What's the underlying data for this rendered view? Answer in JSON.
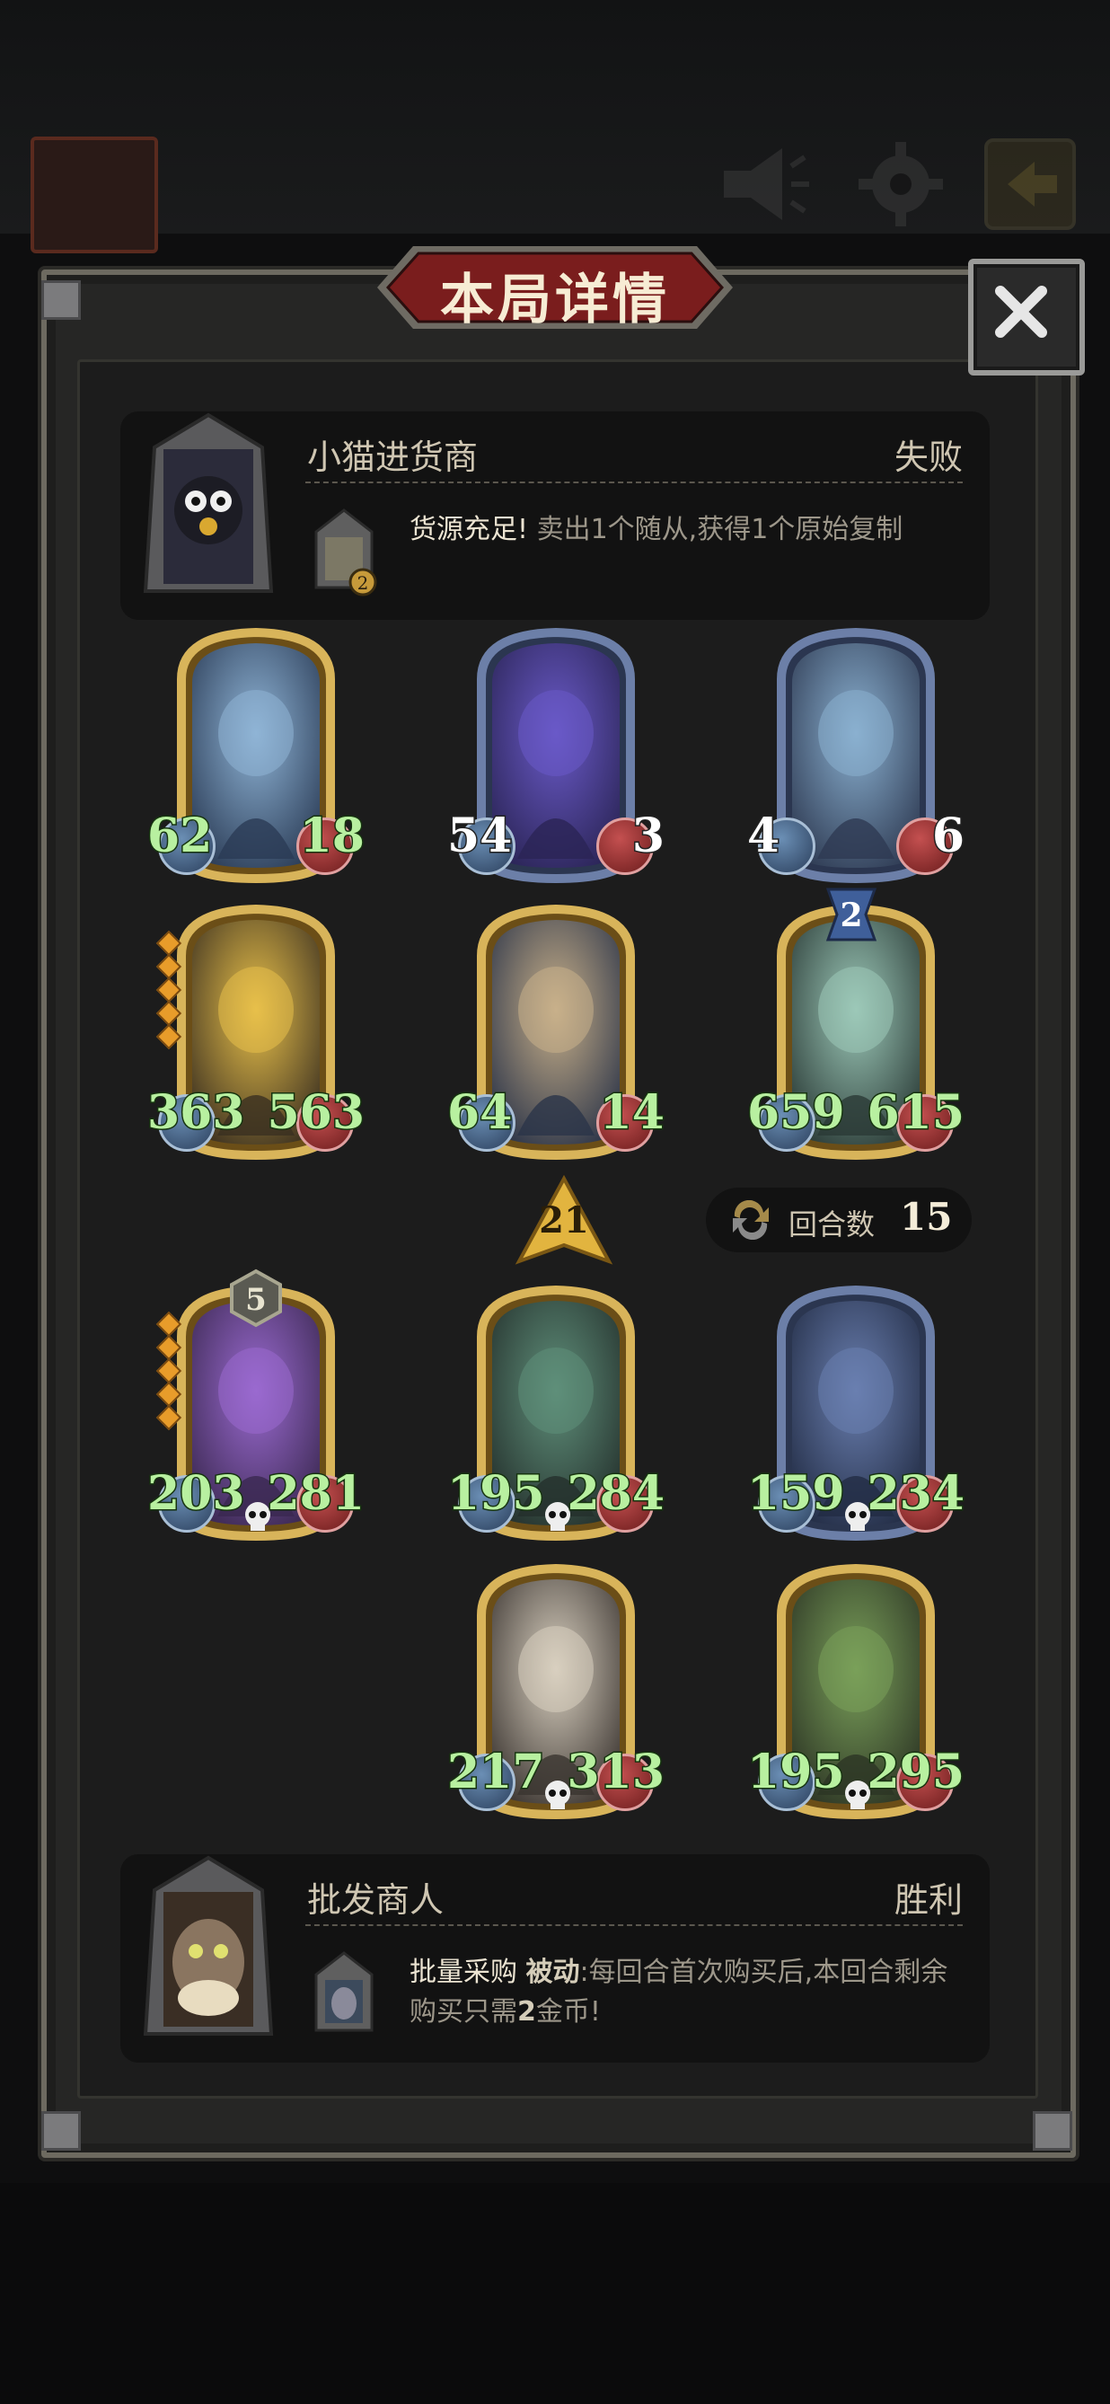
{
  "modal": {
    "title": "本局详情"
  },
  "opponent": {
    "name": "小猫进货商",
    "result": "失败",
    "skill_name": "货源充足!",
    "skill_desc": " 卖出1个随从,获得1个原始复制",
    "skill_level": "2"
  },
  "player": {
    "name": "批发商人",
    "result": "胜利",
    "skill_name": "批量采购 ",
    "skill_keyword": "被动",
    "skill_desc": ":每回合首次购买后,本回合剩余购买只需",
    "skill_highlight": "2",
    "skill_desc_end": "金币!"
  },
  "opponent_units": [
    {
      "atk": "62",
      "hp": "18"
    },
    {
      "atk": "54",
      "hp": "3"
    },
    {
      "atk": "4",
      "hp": "6"
    },
    {
      "atk": "363",
      "hp": "563"
    },
    {
      "atk": "64",
      "hp": "14"
    },
    {
      "atk": "659",
      "hp": "615"
    }
  ],
  "opponent_badge": "2",
  "player_level": "21",
  "round": {
    "label": "回合数",
    "value": "15"
  },
  "player_units": [
    {
      "atk": "203",
      "hp": "281",
      "badge": "5"
    },
    {
      "atk": "195",
      "hp": "284"
    },
    {
      "atk": "159",
      "hp": "234"
    },
    {
      "atk": "217",
      "hp": "313"
    },
    {
      "atk": "195",
      "hp": "295"
    }
  ],
  "colors": {
    "panel": "#262625",
    "banner_red": "#7a1d1d",
    "gold_frame": "#c9a24a",
    "stat_green": "#b8f0a0"
  },
  "icons": [
    "megaphone-icon",
    "gear-icon",
    "exit-icon",
    "close-icon",
    "refresh-icon",
    "skull-icon"
  ]
}
